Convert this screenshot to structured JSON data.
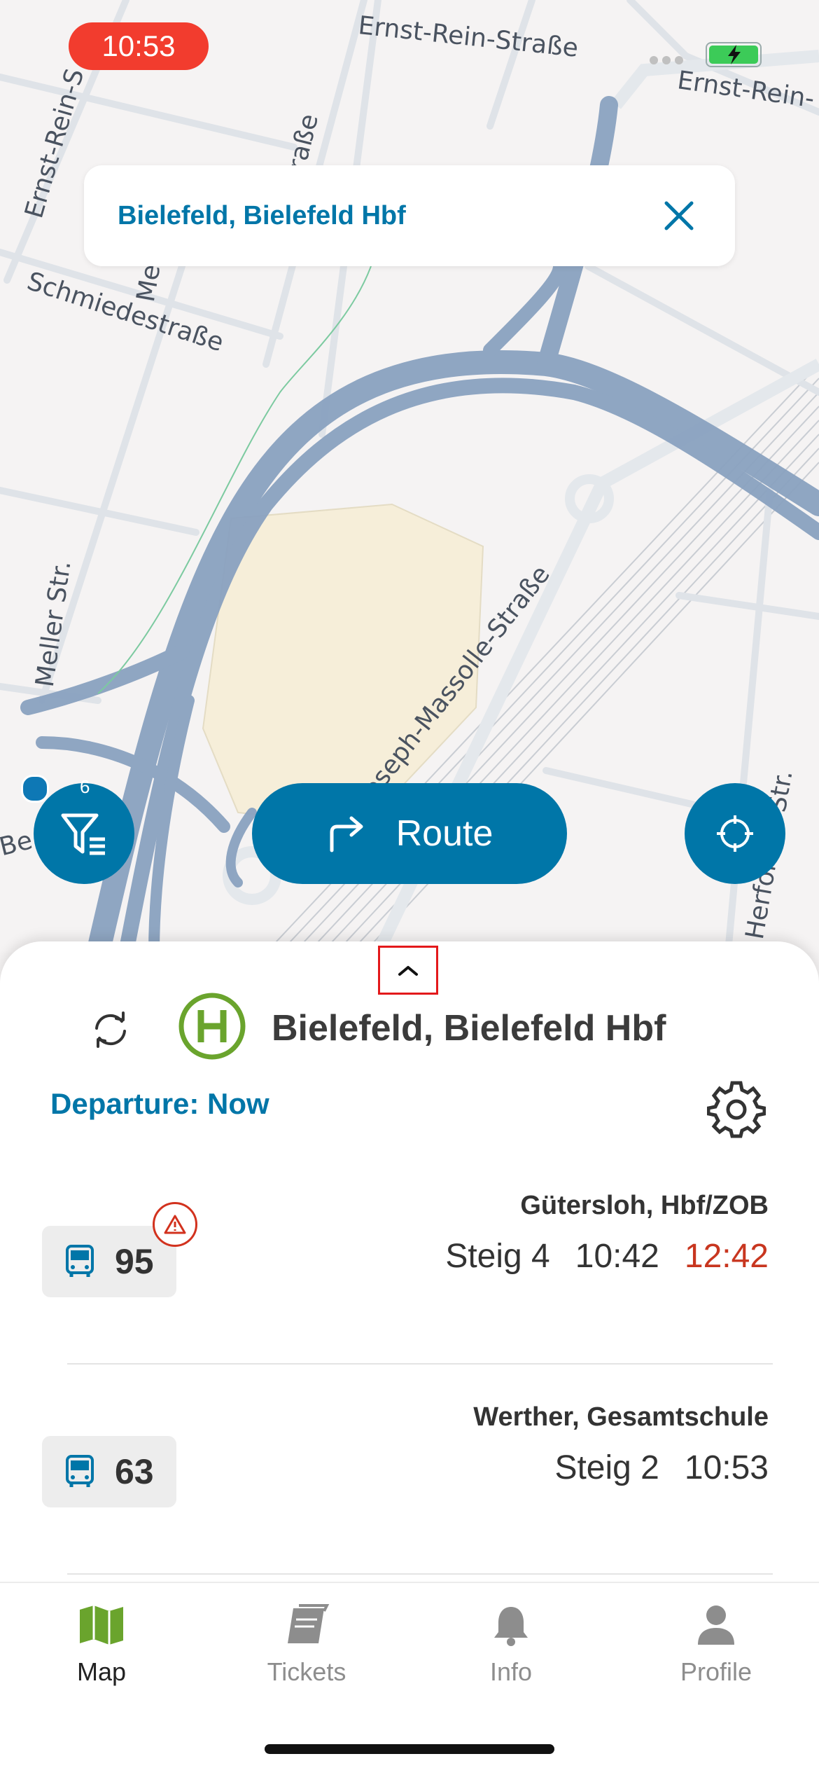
{
  "status_bar": {
    "time": "10:53"
  },
  "map": {
    "streets": [
      "Ernst-Rein-Straße",
      "Ernst-Rein-",
      "Ernst-Rein-S",
      "Schmiedestraße",
      "Meller Str.",
      "Joseph-Massolle-Straße",
      "Herforder Str.",
      "Me",
      "traße",
      "Be"
    ],
    "search": {
      "value": "Bielefeld, Bielefeld Hbf"
    },
    "filter_badge": "6",
    "route_label": "Route"
  },
  "sheet": {
    "stop_name": "Bielefeld, Bielefeld Hbf",
    "departure_label": "Departure: Now",
    "departures": [
      {
        "line": "95",
        "destination": "Gütersloh, Hbf/ZOB",
        "platform": "Steig 4",
        "time": "10:42",
        "delayed_time": "12:42",
        "warning": true
      },
      {
        "line": "63",
        "destination": "Werther, Gesamtschule",
        "platform": "Steig 2",
        "time": "10:53"
      }
    ]
  },
  "tabs": [
    {
      "label": "Map",
      "active": true
    },
    {
      "label": "Tickets"
    },
    {
      "label": "Info"
    },
    {
      "label": "Profile"
    }
  ],
  "colors": {
    "brand": "#0076a8",
    "alert": "#c8361f",
    "stop_green": "#6aa42d"
  }
}
